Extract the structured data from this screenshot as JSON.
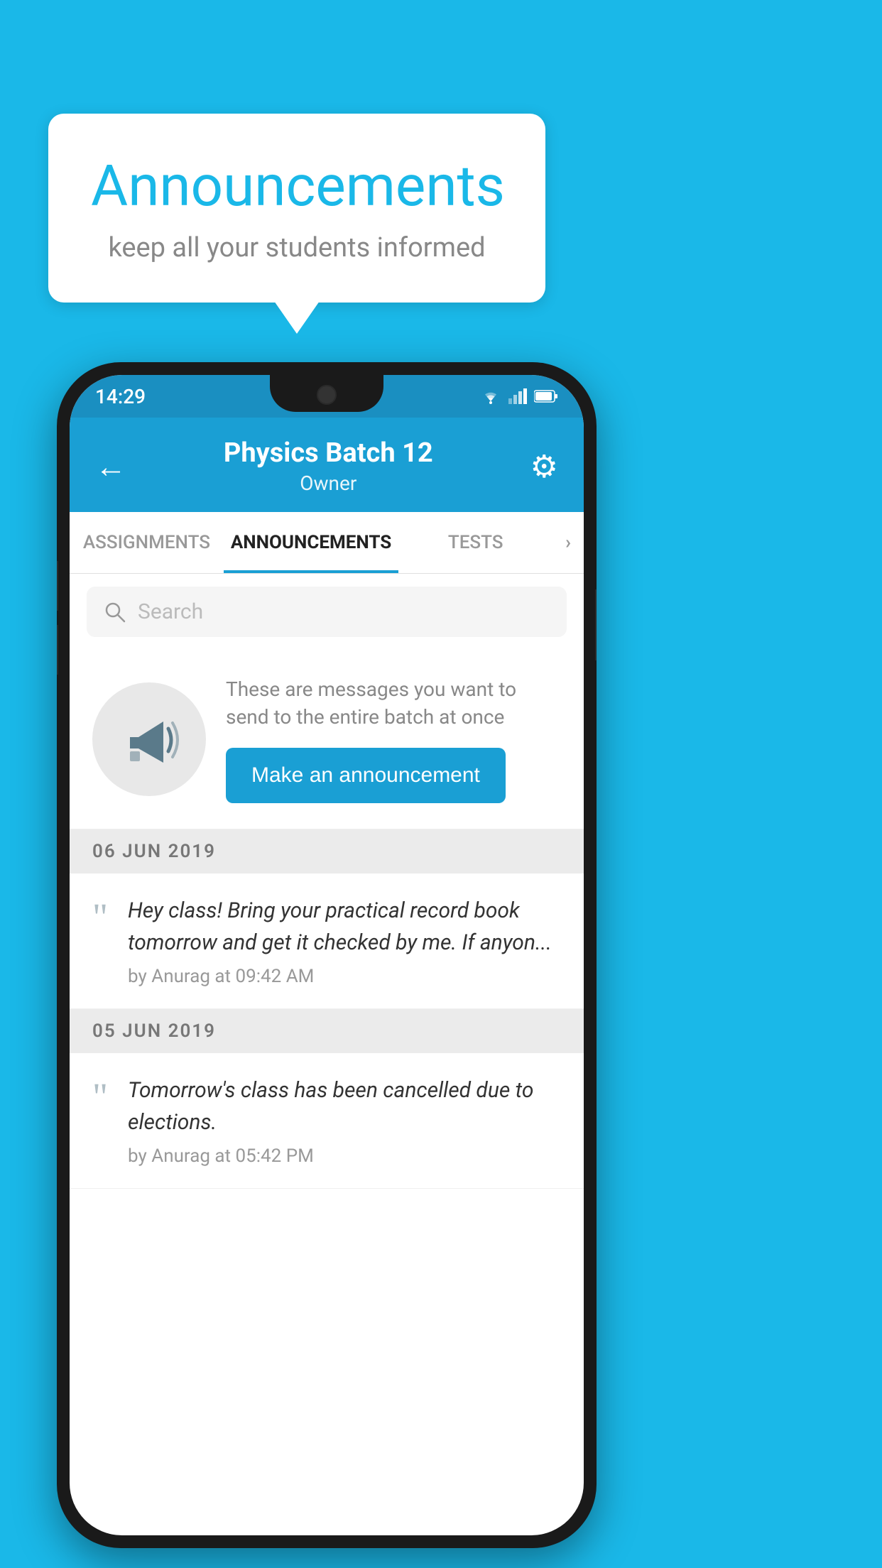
{
  "background_color": "#1ab8e8",
  "speech_bubble": {
    "title": "Announcements",
    "subtitle": "keep all your students informed"
  },
  "phone": {
    "status_bar": {
      "time": "14:29",
      "icons": [
        "wifi",
        "signal",
        "battery"
      ]
    },
    "header": {
      "back_label": "←",
      "title": "Physics Batch 12",
      "subtitle": "Owner",
      "gear_label": "⚙"
    },
    "tabs": [
      {
        "label": "ASSIGNMENTS",
        "active": false
      },
      {
        "label": "ANNOUNCEMENTS",
        "active": true
      },
      {
        "label": "TESTS",
        "active": false
      },
      {
        "label": "›",
        "active": false
      }
    ],
    "search": {
      "placeholder": "Search"
    },
    "promo": {
      "text": "These are messages you want to send to the entire batch at once",
      "button_label": "Make an announcement"
    },
    "announcements": [
      {
        "date": "06  JUN  2019",
        "text": "Hey class! Bring your practical record book tomorrow and get it checked by me. If anyon...",
        "meta": "by Anurag at 09:42 AM"
      },
      {
        "date": "05  JUN  2019",
        "text": "Tomorrow's class has been cancelled due to elections.",
        "meta": "by Anurag at 05:42 PM"
      }
    ]
  }
}
